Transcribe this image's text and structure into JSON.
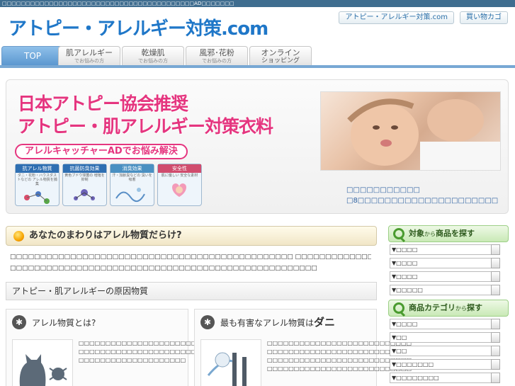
{
  "topbar": {
    "text": "□□□□□□□□□□□□□□□□□□□□□□□□□□□□□□□□□□□□□□□□□AD□□□□□□□"
  },
  "logo": {
    "text": "アトピー・アレルギー対策.com"
  },
  "header": {
    "links": [
      "アトピー・アレルギー対策.com",
      "買い物カゴ"
    ]
  },
  "nav": {
    "tabs": [
      {
        "label": "TOP",
        "sub": ""
      },
      {
        "label": "肌アレルギー",
        "sub": "でお悩みの方"
      },
      {
        "label": "乾燥肌",
        "sub": "でお悩みの方"
      },
      {
        "label": "風邪･花粉",
        "sub": "でお悩みの方"
      },
      {
        "label": "オンライン",
        "sub": "ショッピング"
      }
    ]
  },
  "hero": {
    "title_line1": "日本アトピー協会推奨",
    "title_line2": "アトピー・肌アレルギー対策衣料",
    "pill": "アレルキャッチャーADでお悩み解決",
    "boxes": [
      {
        "title": "抗アレル物質",
        "sub": "ダニ・花粉・ハウスダストなどの アレル物質を捕集"
      },
      {
        "title": "抗菌防臭効果",
        "sub": "黄色ブドウ球菌の 増殖を抑制"
      },
      {
        "title": "消臭効果",
        "sub": "汗・加齢臭などの 臭いを吸着"
      },
      {
        "title": "安全性",
        "sub": "肌に優しい 安全な素材"
      }
    ],
    "caption1": "□□□□□□□□□□□",
    "caption2": "□8□□□□□□□□□□□□□□□□□□□□□"
  },
  "section": {
    "title": "あなたのまわりはアレル物質だらけ?",
    "para1": "□□□□□□□□□□□□□□□□□□□□□□□□□□□□□□□□□□□□□□□□□□□□□□□ □□□□□□□□□□□□□□□□□□□□□□□□□□□",
    "para2": "□□□□□□□□□□□□□□□□□□□□□□□□□□□□□□□□□□□□□□□□□□□□□□□□□□□"
  },
  "subsection": {
    "title": "アトピー・肌アレルギーの原因物質"
  },
  "cards": [
    {
      "title_pre": "アレル物質",
      "title_em": "",
      "title_post": "とは?",
      "lines": [
        "□□□□□□□□□□□□□□□□□□□□□□□□□□",
        "□□□□□□□□□□□□□□□□□□□□□□□□□□",
        "□□□□□□□□□□□□□□□□□□□□"
      ]
    },
    {
      "title_pre": "最も有害なアレル物質は",
      "title_em": "ダニ",
      "title_post": "",
      "lines": [
        "□□□□□□□□□□□□□□□□□□□□□□□□□□□",
        "□□□□□□□□□□□□□□□□□□□□□□□□□□□",
        "□□□□□□□□□□□□□□□□□□□□□□□□□□□",
        "□□□□□□□□□□□□□□□□□□□□□□□□□□□"
      ]
    }
  ],
  "sidebar": {
    "section1": {
      "title_main": "対象",
      "title_small": "から",
      "title_end": "商品を探す",
      "selects": [
        "▼□□□□",
        "▼□□□□",
        "▼□□□□",
        "▼□□□□□"
      ]
    },
    "section2": {
      "title_main": "商品カテゴリ",
      "title_small": "から",
      "title_end": "探す",
      "selects": [
        "▼□□□□",
        "▼□□",
        "▼□□",
        "▼□□□□□□□",
        "▼□□□□□□□□"
      ]
    }
  },
  "colors": {
    "accent_blue": "#1f77c8",
    "pink": "#e5357f",
    "green": "#4a9b2f",
    "nav_line": "#78a8d4"
  }
}
